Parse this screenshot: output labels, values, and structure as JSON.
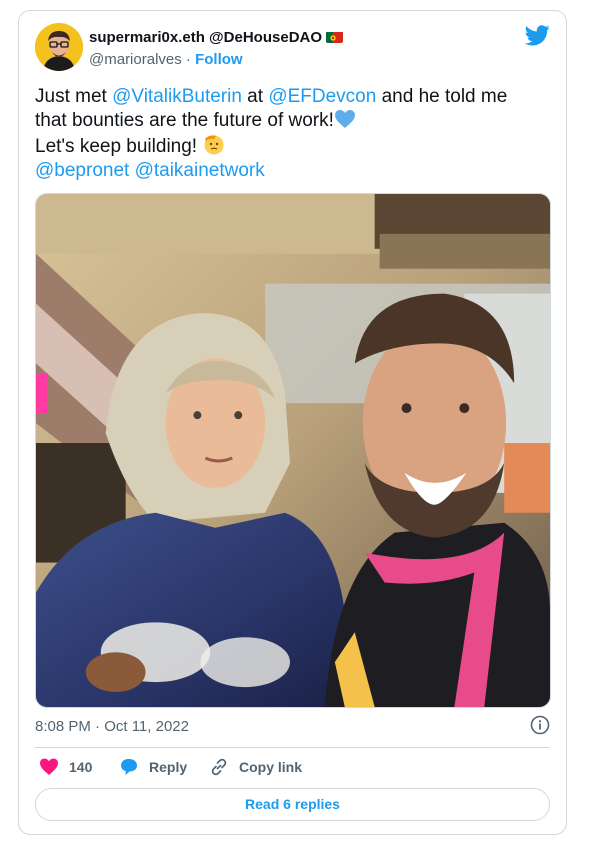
{
  "author": {
    "display_name": "supermari0x.eth @DeHouseDAO",
    "handle": "@marioralves",
    "separator": " · ",
    "follow_label": "Follow",
    "flag_icon": "portugal-flag-icon",
    "brand_icon": "twitter-bird-icon"
  },
  "tweet": {
    "line1": {
      "pre": "Just met ",
      "mention1": "@VitalikButerin",
      "mid": " at ",
      "mention2": "@EFDevcon",
      "post": " and he told me"
    },
    "line2": {
      "text": "that bounties are the future of work!",
      "emoji": "blue-heart-icon"
    },
    "line3": {
      "text": "Let's keep building! ",
      "emoji": "saluting-face-icon"
    },
    "line4": {
      "mention1": "@bepronet",
      "mention2": "@taikainetwork"
    }
  },
  "media": {
    "alt": "photo",
    "icon": "photo-image"
  },
  "timestamp": "8:08 PM · Oct 11, 2022",
  "info_icon": "info-icon",
  "actions": {
    "like_count": "140",
    "reply_label": "Reply",
    "copy_label": "Copy link"
  },
  "read_replies_label": "Read 6 replies",
  "colors": {
    "accent": "#1d9bf0",
    "like": "#f91880",
    "muted": "#536471",
    "border": "#cfd9de"
  }
}
